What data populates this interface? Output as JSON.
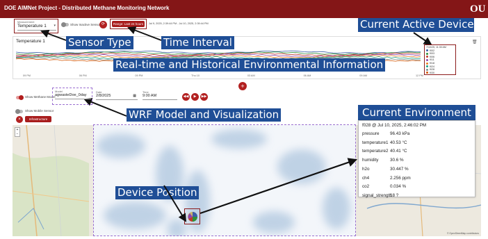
{
  "app": {
    "title": "DOE AIMNet Project - Distributed Methane Monitoring Network",
    "logo": "OU"
  },
  "controls": {
    "measurement_label": "Measurement",
    "measurement_value": "Temperature 1",
    "show_inactive_label": "Show Inactive Sensors",
    "range_button": "Range: Last 24 hours",
    "range_text": "Jul 9, 2025, 2:39:44 PM - Jul 10, 2025, 2:39:44 PM"
  },
  "callouts": {
    "sensor_type": "Sensor Type",
    "time_interval": "Time Interval",
    "current_devices": "Current Active Devices",
    "realtime": "Real-time and Historical Environmental Information",
    "wrf": "WRF Model and Visualization",
    "device_position": "Device Position",
    "current_environment": "Current Environment"
  },
  "chart": {
    "title": "Temperature 1",
    "x_ticks": [
      "09 PM",
      "06 PM",
      "09 PM",
      "Thu 10",
      "03 AM",
      "06 AM",
      "09 AM",
      "12 PM"
    ],
    "tooltip_time": "7/10/25, 11:30 AM",
    "devices": [
      {
        "name": "f002",
        "color": "#3b5ea8"
      },
      {
        "name": "f003",
        "color": "#2f8f3a"
      },
      {
        "name": "f006",
        "color": "#c0392b"
      },
      {
        "name": "f011",
        "color": "#8e44ad"
      },
      {
        "name": "f018",
        "color": "#e67e22"
      },
      {
        "name": "f024",
        "color": "#16a085"
      },
      {
        "name": "f028",
        "color": "#7f8c8d"
      },
      {
        "name": "f030",
        "color": "#d35400"
      }
    ]
  },
  "model": {
    "show_methane_label": "Show Methane Model",
    "model_label": "Model",
    "model_value": "agwasteDoe_0day",
    "date_label": "Date",
    "date_value": "2/8/2025",
    "time_label": "Time",
    "time_value": "9:00 AM",
    "show_mobile_label": "Show Mobile Sensor",
    "infrastructure_label": "Infrastructure"
  },
  "environment": {
    "header": "f028 @ Jul 10, 2025, 2:46:02 PM",
    "rows": [
      {
        "key": "pressure",
        "value": "96.43 kPa"
      },
      {
        "key": "temperature1",
        "value": "40.53 °C"
      },
      {
        "key": "temperature2",
        "value": "40.41 °C"
      },
      {
        "key": "humidity",
        "value": "30.6 %"
      },
      {
        "key": "h2o",
        "value": "30.447 %"
      },
      {
        "key": "ch4",
        "value": "2.256 ppm"
      },
      {
        "key": "co2",
        "value": "0.034 %"
      },
      {
        "key": "signal_strength",
        "value": "18 ?"
      }
    ]
  },
  "map": {
    "attribution": "© OpenStreetMap contributors"
  },
  "colors": {
    "brand": "#841617",
    "callout": "#1f4e96",
    "accent": "#a81d1d"
  }
}
